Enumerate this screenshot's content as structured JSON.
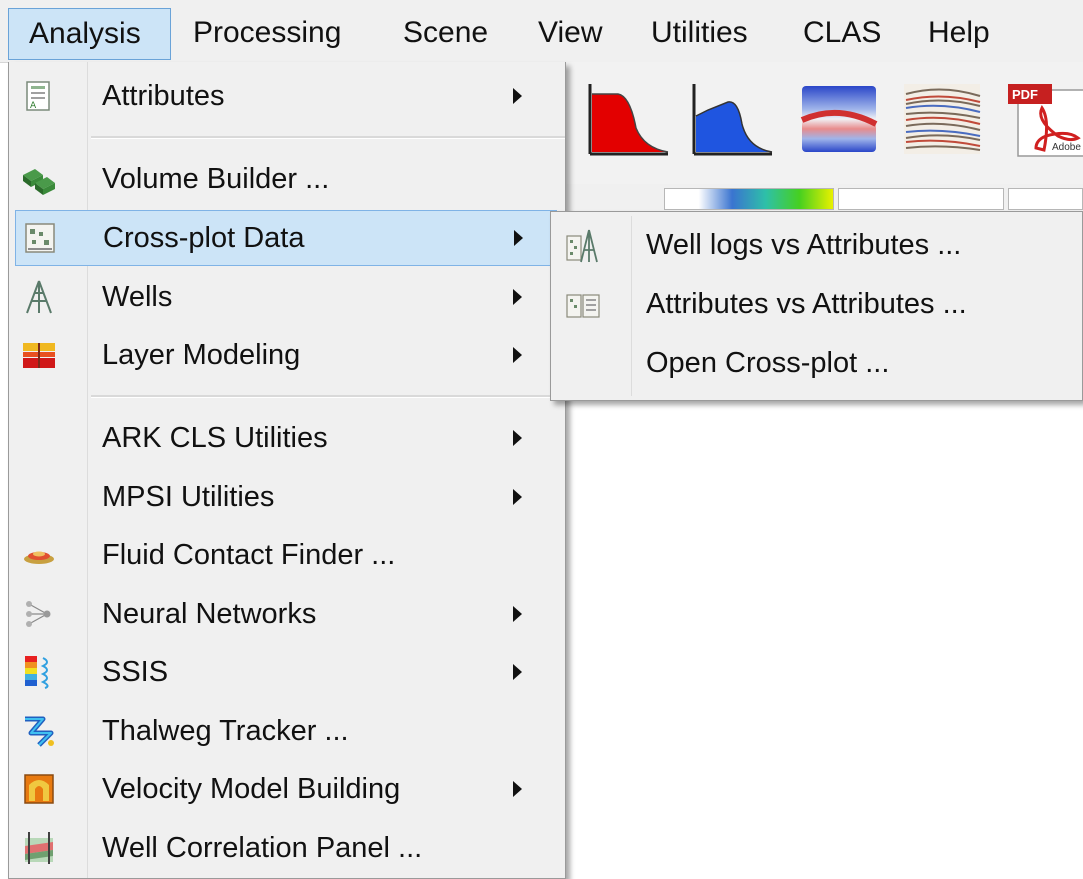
{
  "menubar": {
    "items": [
      {
        "label": "Analysis",
        "active": true
      },
      {
        "label": "Processing"
      },
      {
        "label": "Scene"
      },
      {
        "label": "View"
      },
      {
        "label": "Utilities"
      },
      {
        "label": "CLAS"
      },
      {
        "label": "Help"
      }
    ]
  },
  "toolbar": {
    "icons": [
      "red-area-chart-icon",
      "blue-area-chart-icon",
      "seismic-section-icon",
      "seismic-traces-icon",
      "pdf-icon"
    ],
    "pdf_label": "PDF",
    "pdf_brand": "Adobe"
  },
  "analysis_menu": {
    "items": [
      {
        "label": "Attributes",
        "icon": "attributes-icon",
        "submenu": true
      },
      {
        "label": "Volume Builder ...",
        "icon": "volume-builder-icon",
        "submenu": false
      },
      {
        "label": "Cross-plot Data",
        "icon": "crossplot-icon",
        "submenu": true,
        "highlighted": true
      },
      {
        "label": "Wells",
        "icon": "well-icon",
        "submenu": true
      },
      {
        "label": "Layer Modeling",
        "icon": "layer-modeling-icon",
        "submenu": true
      },
      {
        "label": "ARK CLS Utilities",
        "icon": "",
        "submenu": true
      },
      {
        "label": "MPSI Utilities",
        "icon": "",
        "submenu": true
      },
      {
        "label": "Fluid Contact Finder ...",
        "icon": "fluid-contact-icon",
        "submenu": false
      },
      {
        "label": "Neural Networks",
        "icon": "neural-network-icon",
        "submenu": true
      },
      {
        "label": "SSIS",
        "icon": "ssis-icon",
        "submenu": true
      },
      {
        "label": "Thalweg Tracker ...",
        "icon": "thalweg-icon",
        "submenu": false
      },
      {
        "label": "Velocity Model Building",
        "icon": "velocity-model-icon",
        "submenu": true
      },
      {
        "label": "Well Correlation Panel ...",
        "icon": "well-correlation-icon",
        "submenu": false
      }
    ]
  },
  "crossplot_submenu": {
    "items": [
      {
        "label": "Well logs vs Attributes ...",
        "icon": "well-logs-crossplot-icon"
      },
      {
        "label": "Attributes vs Attributes ...",
        "icon": "attributes-crossplot-icon"
      },
      {
        "label": "Open Cross-plot ...",
        "icon": ""
      }
    ]
  },
  "colors": {
    "menu_bg": "#f0f0f0",
    "highlight_bg": "#cce4f7",
    "highlight_border": "#7fb3e6"
  }
}
